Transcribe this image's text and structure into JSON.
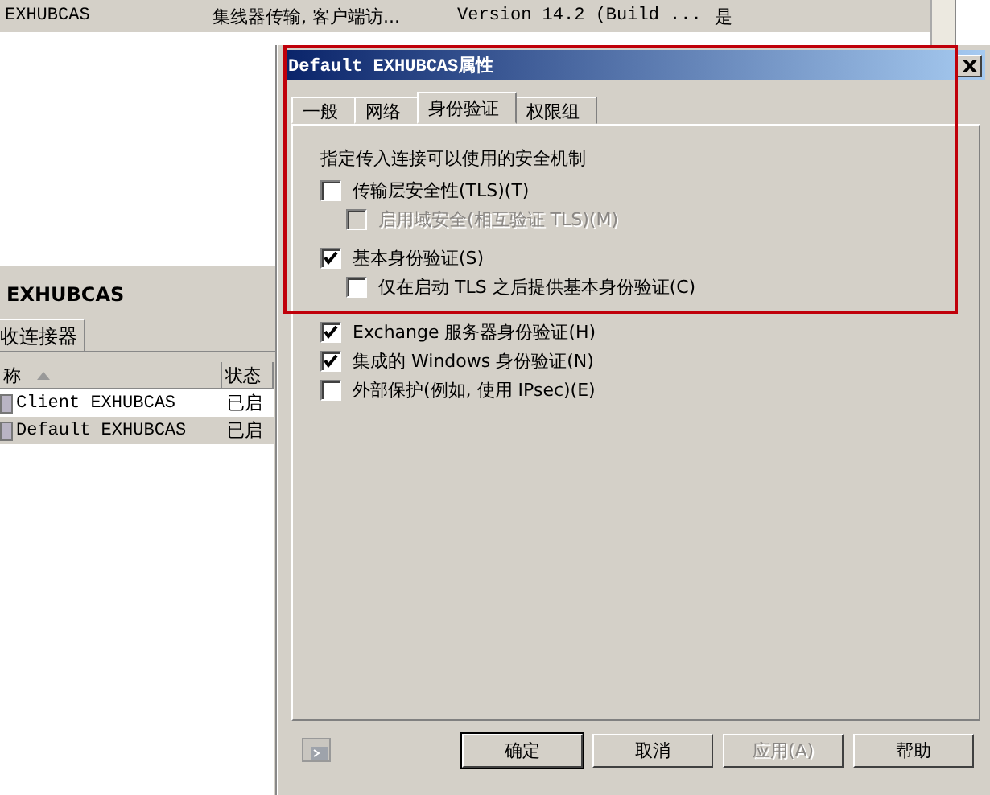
{
  "background_list": {
    "row": {
      "cells": [
        "EXHUBCAS",
        "集线器传输, 客户端访...",
        "Version 14.2 (Build ...",
        "是"
      ],
      "selected": true
    }
  },
  "server_panel": {
    "title": "EXHUBCAS",
    "tabs": [
      {
        "label": "收连接器",
        "selected": true
      }
    ],
    "columns": [
      "称",
      "状态"
    ],
    "rows": [
      {
        "name": "Client EXHUBCAS",
        "status": "已启",
        "selected": false
      },
      {
        "name": "Default EXHUBCAS",
        "status": "已启",
        "selected": true
      }
    ]
  },
  "dialog": {
    "title": "Default EXHUBCAS属性",
    "tabs": [
      {
        "label": "一般",
        "selected": false
      },
      {
        "label": "网络",
        "selected": false
      },
      {
        "label": "身份验证",
        "selected": true
      },
      {
        "label": "权限组",
        "selected": false
      }
    ],
    "group_label": "指定传入连接可以使用的安全机制",
    "options": [
      {
        "label": "传输层安全性(TLS)(T)",
        "checked": false,
        "disabled": false,
        "children": [
          {
            "label": "启用域安全(相互验证 TLS)(M)",
            "checked": false,
            "disabled": true
          }
        ]
      },
      {
        "label": "基本身份验证(S)",
        "checked": true,
        "disabled": false,
        "children": [
          {
            "label": "仅在启动 TLS 之后提供基本身份验证(C)",
            "checked": false,
            "disabled": false
          }
        ]
      },
      {
        "label": "Exchange 服务器身份验证(H)",
        "checked": true,
        "disabled": false
      },
      {
        "label": "集成的 Windows 身份验证(N)",
        "checked": true,
        "disabled": false
      },
      {
        "label": "外部保护(例如, 使用 IPsec)(E)",
        "checked": false,
        "disabled": false
      }
    ],
    "buttons": [
      {
        "label": "确定",
        "default": true,
        "disabled": false
      },
      {
        "label": "取消",
        "default": false,
        "disabled": false
      },
      {
        "label": "应用(A)",
        "default": false,
        "disabled": true
      },
      {
        "label": "帮助",
        "default": false,
        "disabled": false
      }
    ]
  }
}
